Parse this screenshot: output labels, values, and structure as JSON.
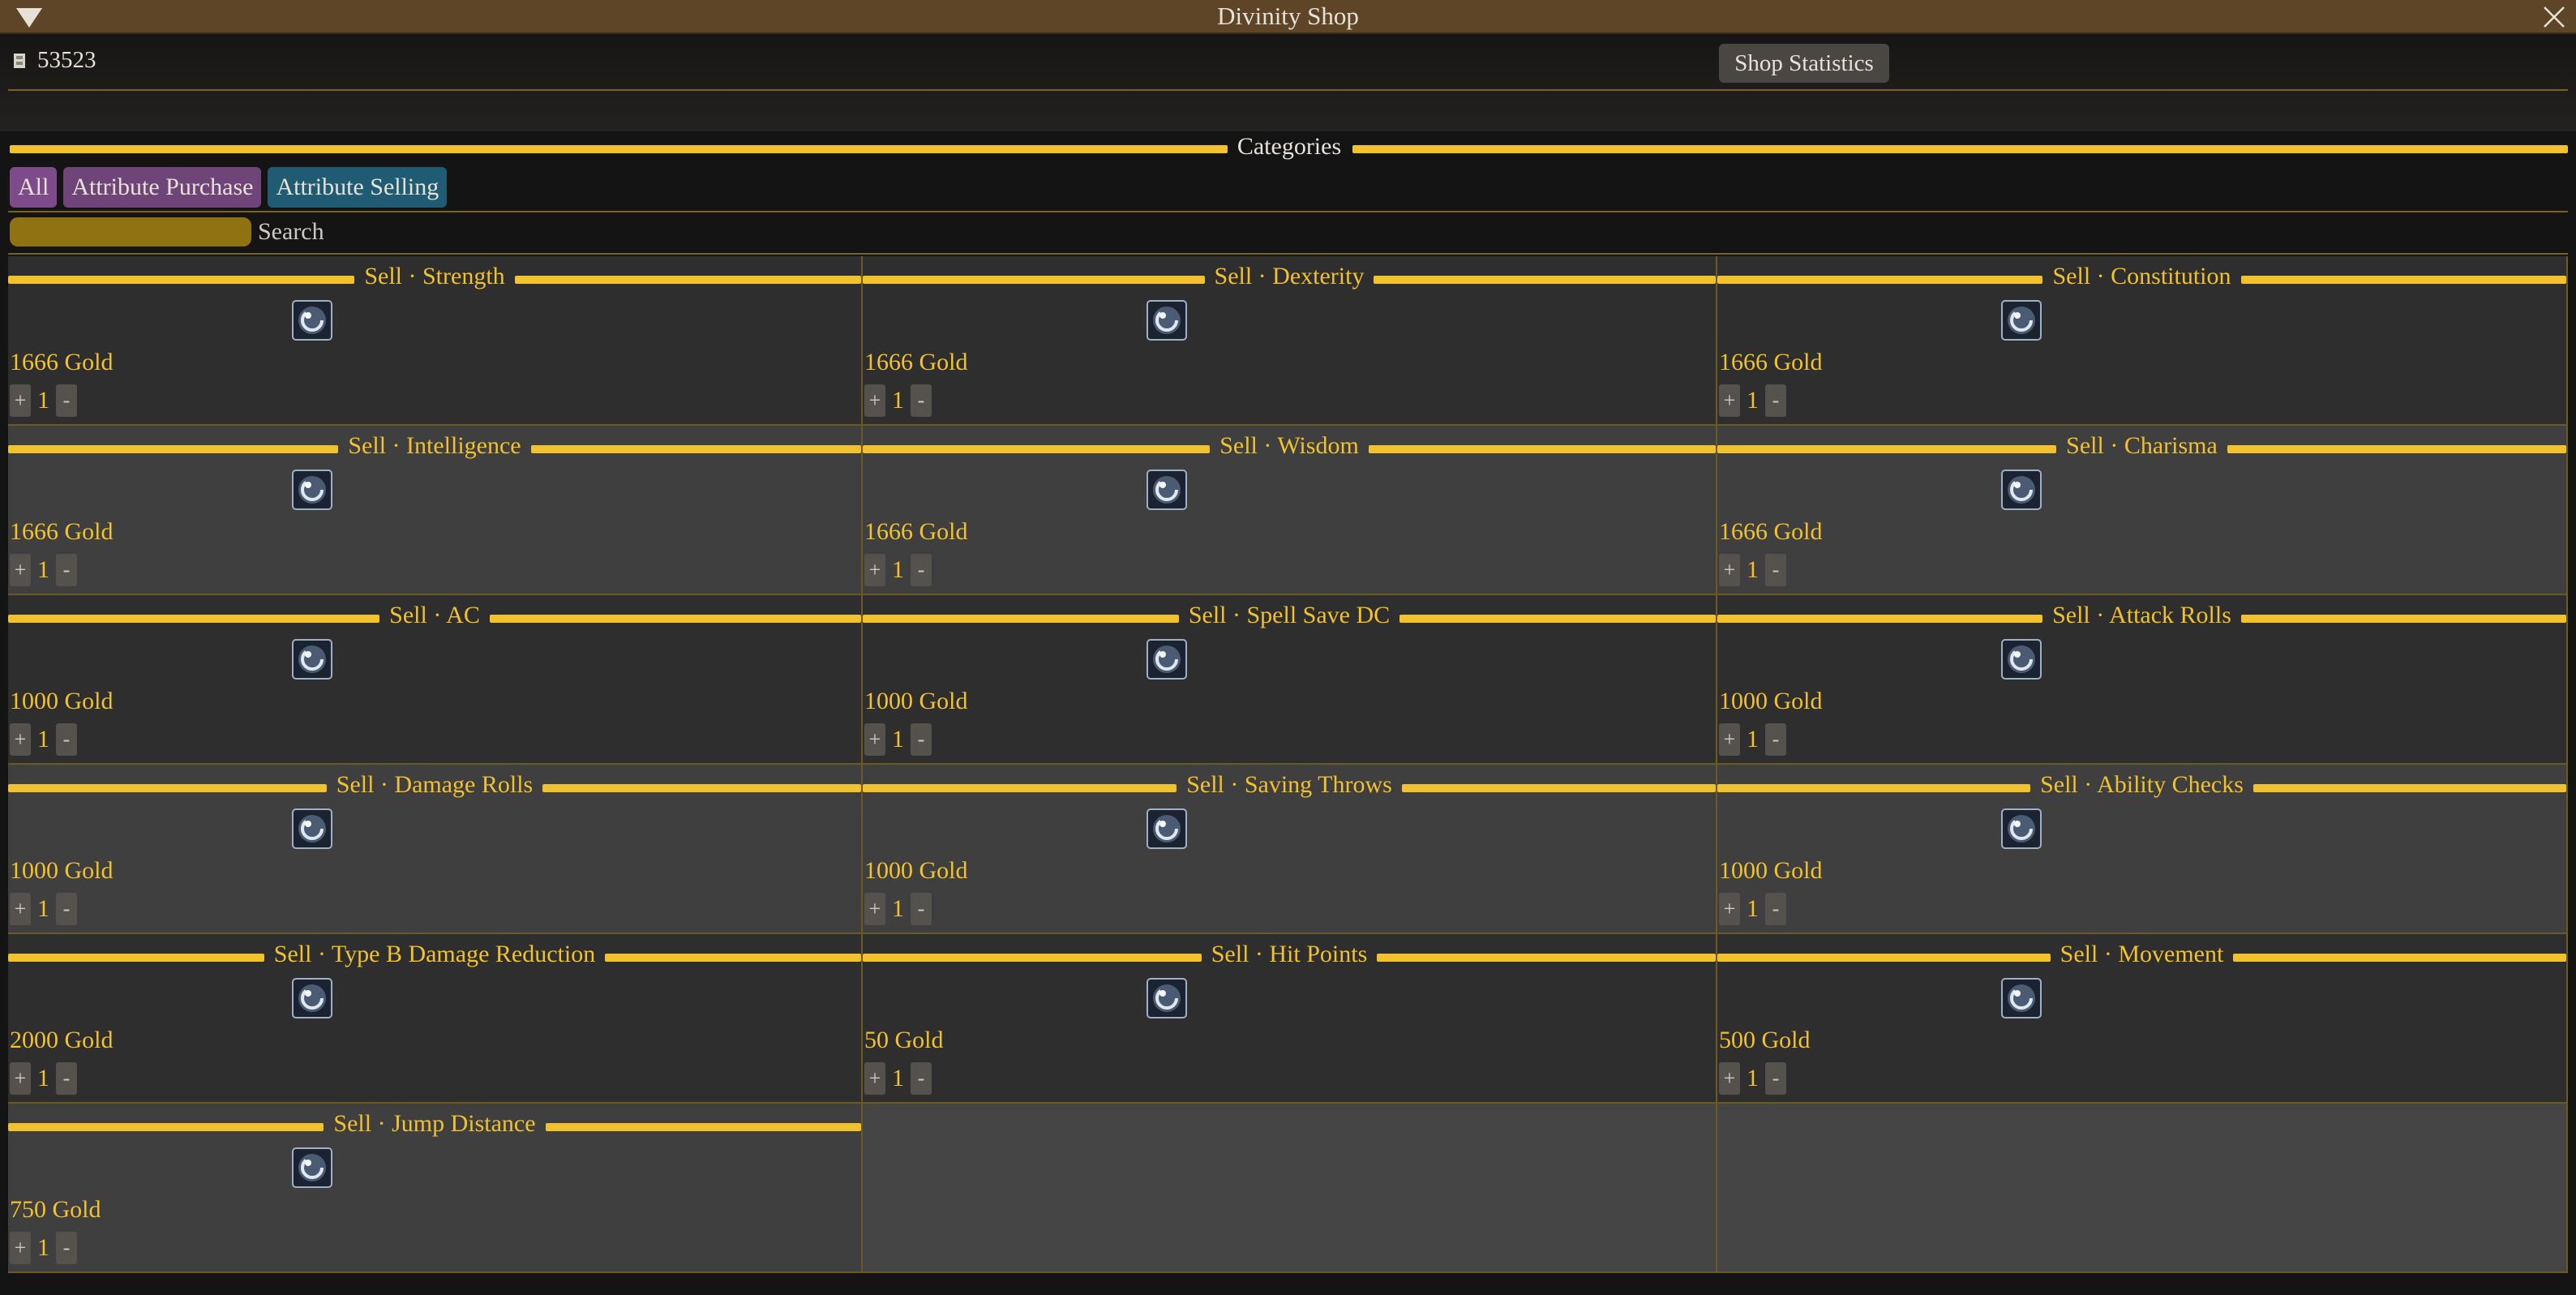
{
  "window": {
    "title": "Divinity Shop"
  },
  "header": {
    "currency_amount": "53523",
    "stats_button": "Shop Statistics"
  },
  "categories": {
    "label": "Categories",
    "tabs": [
      "All",
      "Attribute Purchase",
      "Attribute Selling"
    ]
  },
  "search": {
    "label": "Search"
  },
  "items": [
    {
      "title": "Sell · Strength",
      "price": "1666 Gold",
      "qty": "1"
    },
    {
      "title": "Sell · Dexterity",
      "price": "1666 Gold",
      "qty": "1"
    },
    {
      "title": "Sell · Constitution",
      "price": "1666 Gold",
      "qty": "1"
    },
    {
      "title": "Sell · Intelligence",
      "price": "1666 Gold",
      "qty": "1"
    },
    {
      "title": "Sell · Wisdom",
      "price": "1666 Gold",
      "qty": "1"
    },
    {
      "title": "Sell · Charisma",
      "price": "1666 Gold",
      "qty": "1"
    },
    {
      "title": "Sell · AC",
      "price": "1000 Gold",
      "qty": "1"
    },
    {
      "title": "Sell · Spell Save DC",
      "price": "1000 Gold",
      "qty": "1"
    },
    {
      "title": "Sell · Attack Rolls",
      "price": "1000 Gold",
      "qty": "1"
    },
    {
      "title": "Sell · Damage Rolls",
      "price": "1000 Gold",
      "qty": "1"
    },
    {
      "title": "Sell · Saving Throws",
      "price": "1000 Gold",
      "qty": "1"
    },
    {
      "title": "Sell · Ability Checks",
      "price": "1000 Gold",
      "qty": "1"
    },
    {
      "title": "Sell · Type B Damage Reduction",
      "price": "2000 Gold",
      "qty": "1"
    },
    {
      "title": "Sell · Hit Points",
      "price": "50 Gold",
      "qty": "1"
    },
    {
      "title": "Sell · Movement",
      "price": "500 Gold",
      "qty": "1"
    },
    {
      "title": "Sell · Jump Distance",
      "price": "750 Gold",
      "qty": "1"
    }
  ],
  "controls": {
    "plus": "+",
    "minus": "-"
  },
  "colors": {
    "accent": "#f2c12e",
    "title_bar": "#5e4527",
    "tab_all": "#7e4b8a",
    "tab_purchase": "#6f4478",
    "tab_selling": "#1f5c74"
  }
}
